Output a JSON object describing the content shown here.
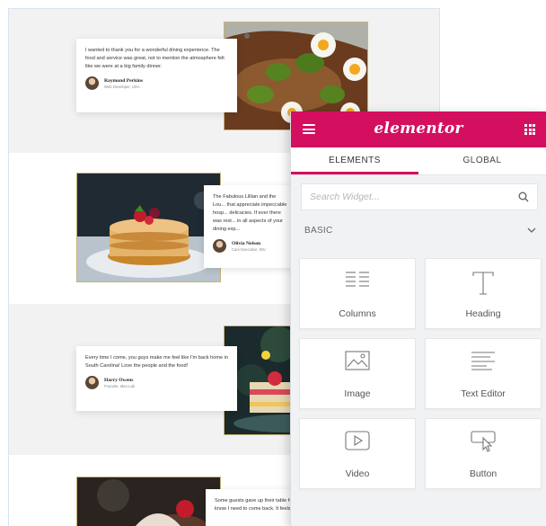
{
  "testimonials": [
    {
      "quote": "I wanted to thank you for a wonderful dining experience. The food and service was great, not to mention the atmosphere felt like we were at a big family dinner.",
      "name": "Raymond Perkins",
      "role": "Web Developer, USA"
    },
    {
      "quote": "The Fabulous Lillian and the Lou... that appreciate impeccable hosp... delicacies. If ever there was rest... in all aspects of your dining exp...",
      "name": "Olivia Nelson",
      "role": "Care Executive, INV"
    },
    {
      "quote": "Every time I come, you guys make me feel like I'm back home in South Carolina! Love the people and the food!",
      "name": "Harry Owens",
      "role": "Founder, Idea Lab"
    },
    {
      "quote": "Some guests gave up their table for us on Mothers Day - so I know I need to come back. It feels like family here! - Thanks",
      "name": "",
      "role": ""
    }
  ],
  "panel": {
    "brand": "elementor",
    "accent_color": "#d40f5f",
    "tabs": [
      {
        "label": "ELEMENTS",
        "active": true
      },
      {
        "label": "GLOBAL",
        "active": false
      }
    ],
    "search_placeholder": "Search Widget...",
    "category": "BASIC",
    "widgets": [
      {
        "label": "Columns",
        "icon": "columns-icon"
      },
      {
        "label": "Heading",
        "icon": "heading-icon"
      },
      {
        "label": "Image",
        "icon": "image-icon"
      },
      {
        "label": "Text Editor",
        "icon": "text-editor-icon"
      },
      {
        "label": "Video",
        "icon": "video-icon"
      },
      {
        "label": "Button",
        "icon": "button-icon"
      }
    ]
  }
}
